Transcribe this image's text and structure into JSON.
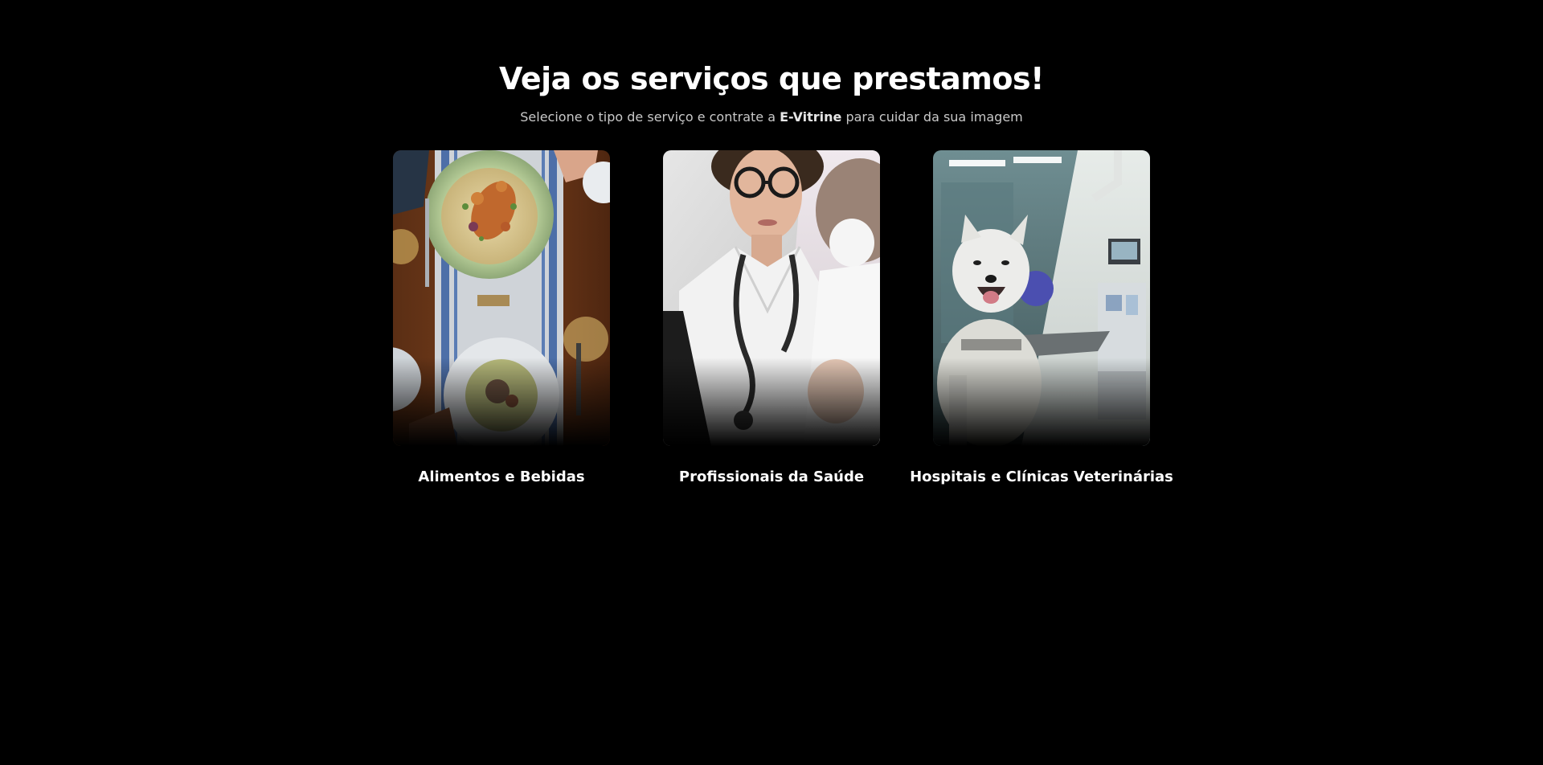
{
  "header": {
    "title": "Veja os serviços que prestamos!",
    "subtitle_before": "Selecione o tipo de serviço e contrate a",
    "subtitle_brand": "E-Vitrine",
    "subtitle_after": "para cuidar da sua imagem"
  },
  "cards": [
    {
      "label": "Alimentos e Bebidas",
      "image": "restaurant-table-photo"
    },
    {
      "label": "Profissionais da Saúde",
      "image": "doctor-and-dentist-photo"
    },
    {
      "label": "Hospitais e Clínicas Veterinárias",
      "image": "dog-and-clinic-photo"
    }
  ],
  "colors": {
    "background": "#000000",
    "text": "#ffffff",
    "subtitle_text": "#c9c9c9"
  }
}
